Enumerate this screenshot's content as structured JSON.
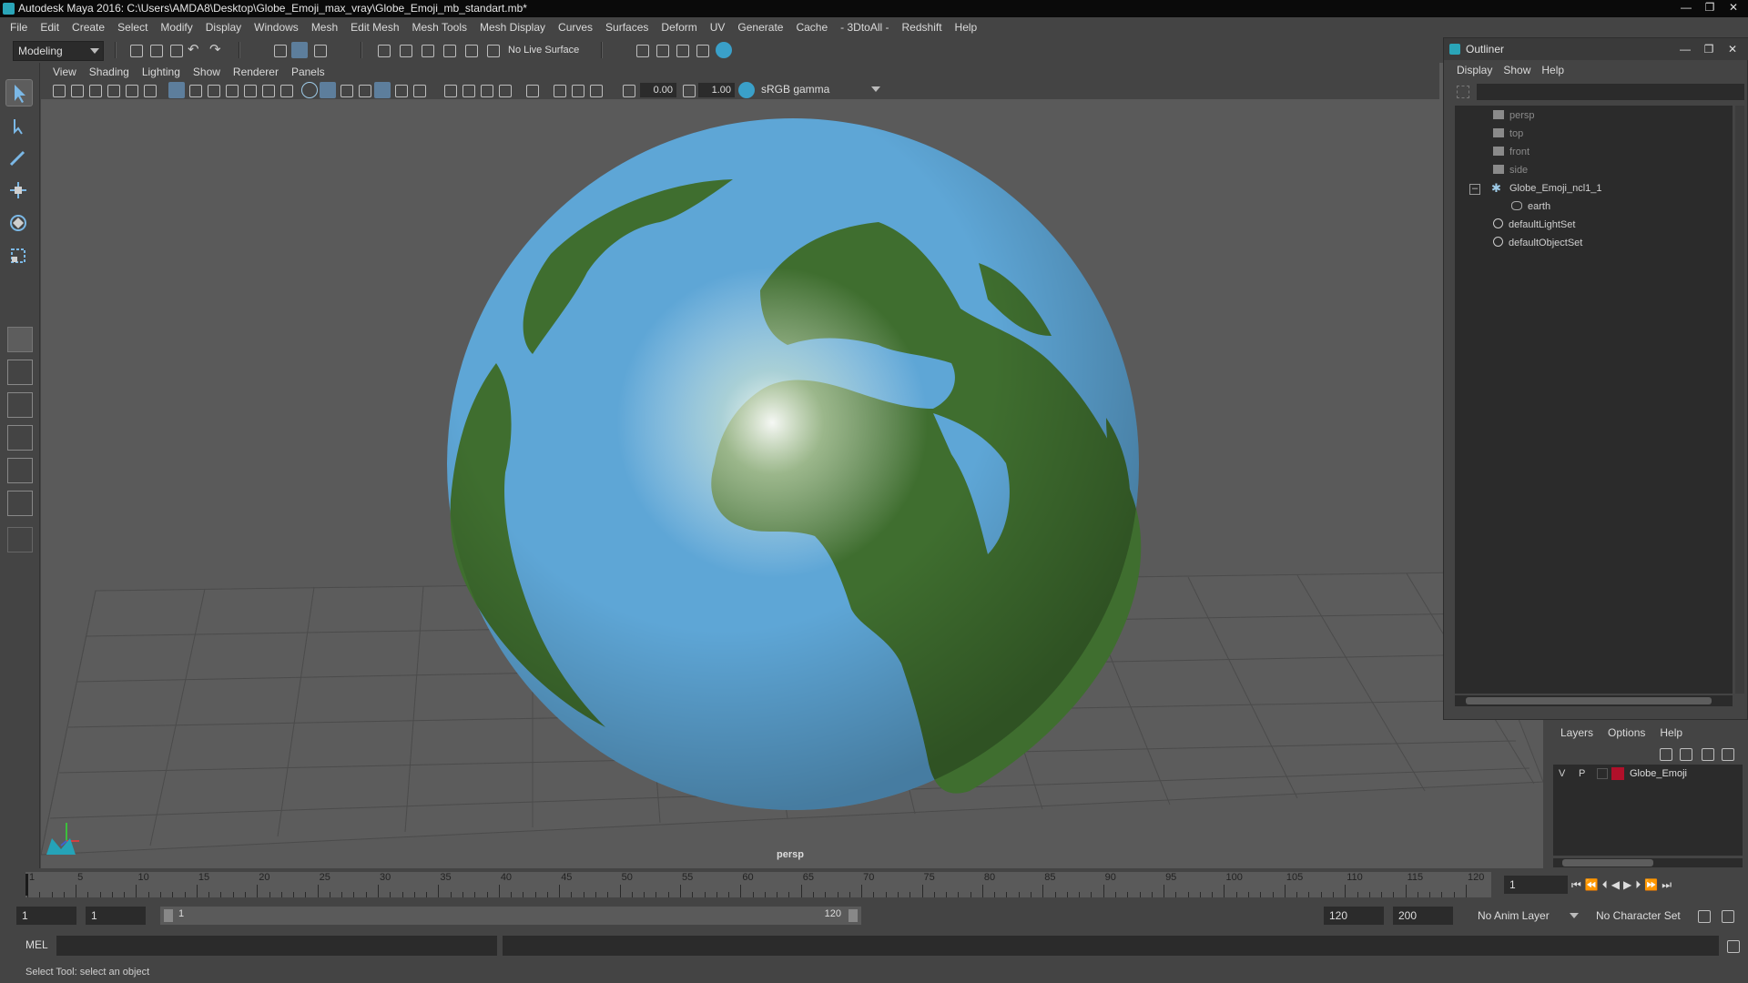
{
  "window": {
    "title": "Autodesk Maya 2016: C:\\Users\\AMDA8\\Desktop\\Globe_Emoji_max_vray\\Globe_Emoji_mb_standart.mb*",
    "controls": [
      "—",
      "❐",
      "✕"
    ]
  },
  "menubar": [
    "File",
    "Edit",
    "Create",
    "Select",
    "Modify",
    "Display",
    "Windows",
    "Mesh",
    "Edit Mesh",
    "Mesh Tools",
    "Mesh Display",
    "Curves",
    "Surfaces",
    "Deform",
    "UV",
    "Generate",
    "Cache",
    "- 3DtoAll -",
    "Redshift",
    "Help"
  ],
  "statusline": {
    "mode": "Modeling",
    "live_surface": "No Live Surface"
  },
  "panel": {
    "menus": [
      "View",
      "Shading",
      "Lighting",
      "Show",
      "Renderer",
      "Panels"
    ],
    "exposure": "0.00",
    "gamma": "1.00",
    "color_space": "sRGB gamma",
    "camera_label": "persp"
  },
  "outliner": {
    "title": "Outliner",
    "menus": [
      "Display",
      "Show",
      "Help"
    ],
    "items": [
      {
        "label": "persp",
        "icon": "camera-icon",
        "dim": true,
        "indent": 0
      },
      {
        "label": "top",
        "icon": "camera-icon",
        "dim": true,
        "indent": 0
      },
      {
        "label": "front",
        "icon": "camera-icon",
        "dim": true,
        "indent": 0
      },
      {
        "label": "side",
        "icon": "camera-icon",
        "dim": true,
        "indent": 0
      },
      {
        "label": "Globe_Emoji_ncl1_1",
        "icon": "group-icon",
        "dim": false,
        "indent": 0
      },
      {
        "label": "earth",
        "icon": "mesh-icon",
        "dim": false,
        "indent": 1
      },
      {
        "label": "defaultLightSet",
        "icon": "set-icon",
        "dim": false,
        "indent": 0
      },
      {
        "label": "defaultObjectSet",
        "icon": "set-icon",
        "dim": false,
        "indent": 0
      }
    ]
  },
  "layers": {
    "menus": [
      "Layers",
      "Options",
      "Help"
    ],
    "rows": [
      {
        "v": "V",
        "p": "P",
        "name": "Globe_Emoji",
        "color": "#b0102a"
      }
    ]
  },
  "timeline": {
    "ticks": [
      1,
      5,
      10,
      15,
      20,
      25,
      30,
      35,
      40,
      45,
      50,
      55,
      60,
      65,
      70,
      75,
      80,
      85,
      90,
      95,
      100,
      105,
      110,
      115,
      120
    ],
    "current_frame": "1"
  },
  "range": {
    "start": "1",
    "playback_start": "1",
    "slider_start": "1",
    "slider_end": "120",
    "playback_end": "120",
    "end": "200",
    "anim_layer": "No Anim Layer",
    "character_set": "No Character Set"
  },
  "cmdline": {
    "label": "MEL"
  },
  "helpline": {
    "text": "Select Tool: select an object"
  },
  "colors": {
    "ocean": "#5ea6d6",
    "land": "#3f6e2f",
    "viewport": "#5a5a5a",
    "grid": "#4e4e4e",
    "layer_red": "#b0102a"
  }
}
